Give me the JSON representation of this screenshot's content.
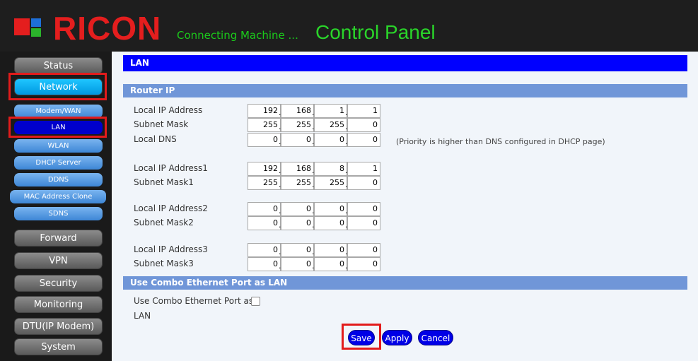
{
  "header": {
    "logo_text": "RICON",
    "tagline": "Connecting Machine ...",
    "title": "Control Panel",
    "logo_colors": [
      "#e41e1e",
      "#1e6fd9",
      "#2bb32b"
    ]
  },
  "sidebar": {
    "items": [
      {
        "label": "Status",
        "active": false
      },
      {
        "label": "Network",
        "active": true
      },
      {
        "label": "Forward",
        "active": false
      },
      {
        "label": "VPN",
        "active": false
      },
      {
        "label": "Security",
        "active": false
      },
      {
        "label": "Monitoring",
        "active": false
      },
      {
        "label": "DTU(IP Modem)",
        "active": false
      },
      {
        "label": "System",
        "active": false
      }
    ],
    "subitems": [
      {
        "label": "Modem/WAN",
        "active": false
      },
      {
        "label": "LAN",
        "active": true
      },
      {
        "label": "WLAN",
        "active": false
      },
      {
        "label": "DHCP Server",
        "active": false
      },
      {
        "label": "DDNS",
        "active": false
      },
      {
        "label": "MAC Address Clone",
        "active": false
      },
      {
        "label": "SDNS",
        "active": false
      }
    ]
  },
  "main": {
    "page_title": "LAN",
    "router_ip_header": "Router IP",
    "fields": [
      {
        "label": "Local IP Address",
        "octets": [
          "192",
          "168",
          "1",
          "1"
        ]
      },
      {
        "label": "Subnet Mask",
        "octets": [
          "255",
          "255",
          "255",
          "0"
        ]
      },
      {
        "label": "Local DNS",
        "octets": [
          "0",
          "0",
          "0",
          "0"
        ]
      },
      {
        "label": "Local IP Address1",
        "octets": [
          "192",
          "168",
          "8",
          "1"
        ]
      },
      {
        "label": "Subnet Mask1",
        "octets": [
          "255",
          "255",
          "255",
          "0"
        ]
      },
      {
        "label": "Local IP Address2",
        "octets": [
          "0",
          "0",
          "0",
          "0"
        ]
      },
      {
        "label": "Subnet Mask2",
        "octets": [
          "0",
          "0",
          "0",
          "0"
        ]
      },
      {
        "label": "Local IP Address3",
        "octets": [
          "0",
          "0",
          "0",
          "0"
        ]
      },
      {
        "label": "Subnet Mask3",
        "octets": [
          "0",
          "0",
          "0",
          "0"
        ]
      }
    ],
    "dns_note": "(Priority is higher than DNS configured in DHCP page)",
    "combo_header": "Use Combo Ethernet Port as LAN",
    "combo_label_line1": "Use Combo Ethernet Port as",
    "combo_label_line2": "LAN",
    "combo_checked": false,
    "buttons": {
      "save": "Save",
      "apply": "Apply",
      "cancel": "Cancel"
    }
  },
  "colors": {
    "accent_blue": "#0000ff",
    "section_blue": "#7096d8",
    "highlight_red": "#e21b1b",
    "active_cyan": "#1fc6ff"
  }
}
